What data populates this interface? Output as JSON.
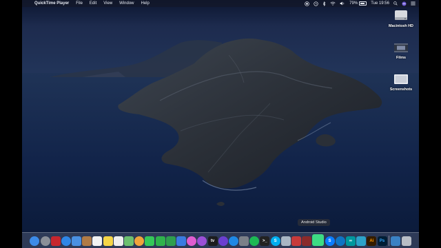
{
  "menubar": {
    "apple_glyph": "",
    "app_name": "QuickTime Player",
    "menus": [
      "File",
      "Edit",
      "View",
      "Window",
      "Help"
    ],
    "status": {
      "battery_percent": "79%",
      "battery_level": 0.79,
      "clock": "Tue 19:56"
    }
  },
  "desktop_icons": [
    {
      "name": "Macintosh HD",
      "icon": "hard-drive-icon"
    },
    {
      "name": "Films",
      "icon": "film-folder-icon"
    },
    {
      "name": "Screenshots",
      "icon": "screenshots-folder-icon"
    }
  ],
  "dock": {
    "tooltip": "Android Studio",
    "items": [
      {
        "icon": "finder-icon",
        "glyph": "",
        "color": "#3d8be8"
      },
      {
        "icon": "launchpad-icon",
        "glyph": "",
        "color": "#8b8f98"
      },
      {
        "icon": "photo-booth-icon",
        "glyph": "",
        "color": "#c6262e"
      },
      {
        "icon": "safari-icon",
        "glyph": "",
        "color": "#2f86e6"
      },
      {
        "icon": "mail-icon",
        "glyph": "",
        "color": "#4a90e2"
      },
      {
        "icon": "contacts-icon",
        "glyph": "",
        "color": "#b07b46"
      },
      {
        "icon": "calendar-icon",
        "glyph": "",
        "color": "#f2f2f2"
      },
      {
        "icon": "notes-icon",
        "glyph": "",
        "color": "#f5d547"
      },
      {
        "icon": "reminders-icon",
        "glyph": "",
        "color": "#efefef"
      },
      {
        "icon": "maps-icon",
        "glyph": "",
        "color": "#6cc070"
      },
      {
        "icon": "photos-icon",
        "glyph": "",
        "color": "#f0a33b"
      },
      {
        "icon": "messages-icon",
        "glyph": "",
        "color": "#35c759"
      },
      {
        "icon": "facetime-icon",
        "glyph": "",
        "color": "#2fb24c"
      },
      {
        "icon": "numbers-icon",
        "glyph": "",
        "color": "#2e9e4e"
      },
      {
        "icon": "keynote-icon",
        "glyph": "",
        "color": "#3a7be0"
      },
      {
        "icon": "itunes-icon",
        "glyph": "",
        "color": "#e05dd0"
      },
      {
        "icon": "podcasts-icon",
        "glyph": "",
        "color": "#9b4fd6"
      },
      {
        "icon": "apple-tv-icon",
        "glyph": "tv",
        "color": "#1c1c1e"
      },
      {
        "icon": "imovie-icon",
        "glyph": "",
        "color": "#6b3fd0"
      },
      {
        "icon": "app-store-icon",
        "glyph": "",
        "color": "#1e88e5"
      },
      {
        "icon": "system-preferences-icon",
        "glyph": "",
        "color": "#7c8088"
      },
      {
        "icon": "spotify-icon",
        "glyph": "",
        "color": "#1db954"
      },
      {
        "icon": "terminal-icon",
        "glyph": ">_",
        "color": "#222"
      },
      {
        "icon": "skype-icon",
        "glyph": "S",
        "color": "#00aff0"
      },
      {
        "icon": "preview-icon",
        "glyph": "",
        "color": "#a9b6c4"
      },
      {
        "icon": "photoshop-plugin-icon",
        "glyph": "",
        "color": "#c73a3a"
      },
      {
        "icon": "game-icon",
        "glyph": "",
        "color": "#8a2b2b"
      },
      {
        "icon": "android-studio-icon",
        "glyph": "",
        "color": "#3ddc84"
      },
      {
        "icon": "shazam-icon",
        "glyph": "S",
        "color": "#0a7cff"
      },
      {
        "icon": "webex-icon",
        "glyph": "",
        "color": "#0f74c4"
      },
      {
        "icon": "arduino-icon",
        "glyph": "∞",
        "color": "#00979d"
      },
      {
        "icon": "vpn-icon",
        "glyph": "",
        "color": "#2ca2c8"
      },
      {
        "icon": "illustrator-icon",
        "glyph": "Ai",
        "color": "#331c00"
      },
      {
        "icon": "photoshop-icon",
        "glyph": "Ps",
        "color": "#001d34"
      }
    ],
    "trailing": [
      {
        "icon": "downloads-stack-icon",
        "glyph": "",
        "color": "#3b82c4"
      },
      {
        "icon": "trash-icon",
        "glyph": "",
        "color": "#b9bec6"
      }
    ]
  }
}
